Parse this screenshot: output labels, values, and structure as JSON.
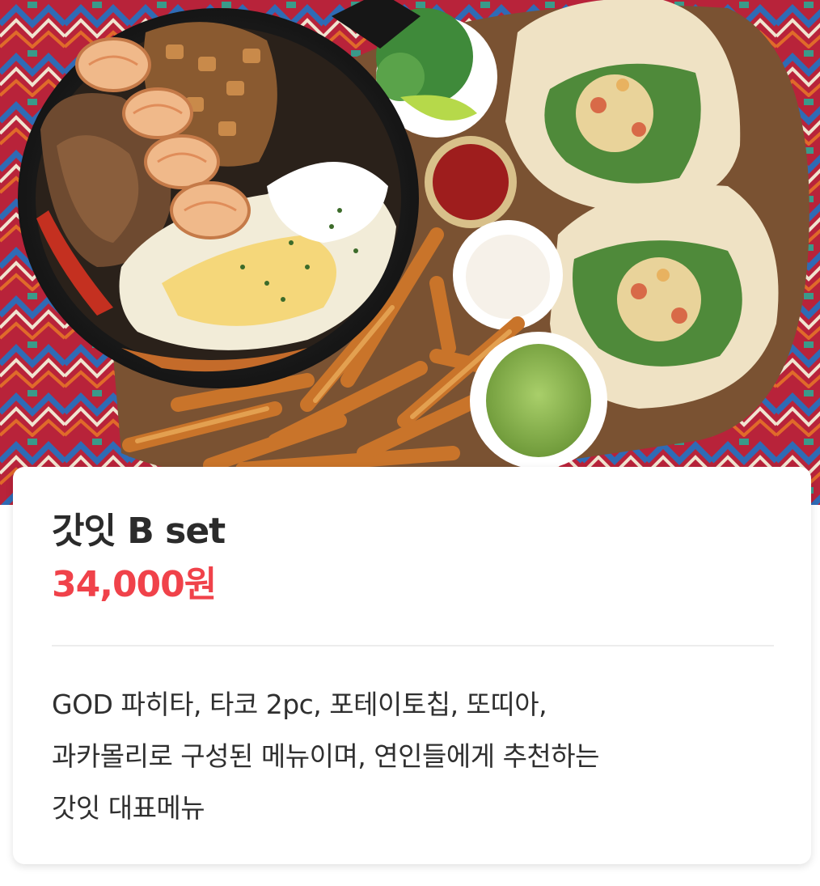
{
  "product": {
    "image": {
      "label": "fajita-taco-set-photo"
    },
    "name": "갓잇 B set",
    "price": "34,000원",
    "description_lines": [
      "GOD 파히타, 타코 2pc, 포테이토칩, 또띠아,",
      "과카몰리로 구성된 메뉴이며, 연인들에게 추천하는",
      "갓잇 대표메뉴"
    ]
  },
  "colors": {
    "price": "#f0424a",
    "title": "#2b2b2b",
    "body_text": "#2f2f2f",
    "divider": "#ececec"
  }
}
